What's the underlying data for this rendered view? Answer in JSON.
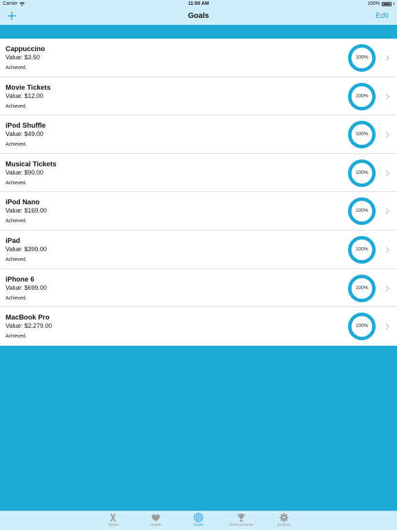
{
  "status_bar": {
    "carrier": "Carrier",
    "time": "11:00 AM",
    "battery": "100%"
  },
  "nav": {
    "title": "Goals",
    "edit_label": "Edit"
  },
  "goals": [
    {
      "name": "Cappuccino",
      "value": "Value: $3.50",
      "status": "Achieved.",
      "percent_label": "100%",
      "progress": 1.0
    },
    {
      "name": "Movie Tickets",
      "value": "Value: $12.00",
      "status": "Achieved.",
      "percent_label": "100%",
      "progress": 1.0
    },
    {
      "name": "iPod Shuffle",
      "value": "Value: $49.00",
      "status": "Achieved.",
      "percent_label": "100%",
      "progress": 1.0
    },
    {
      "name": "Musical Tickets",
      "value": "Value: $90.00",
      "status": "Achieved.",
      "percent_label": "100%",
      "progress": 1.0
    },
    {
      "name": "iPod Nano",
      "value": "Value: $169.00",
      "status": "Achieved.",
      "percent_label": "100%",
      "progress": 1.0
    },
    {
      "name": "iPad",
      "value": "Value: $399.00",
      "status": "Achieved.",
      "percent_label": "100%",
      "progress": 1.0
    },
    {
      "name": "iPhone 6",
      "value": "Value: $699.00",
      "status": "Achieved.",
      "percent_label": "100%",
      "progress": 1.0
    },
    {
      "name": "MacBook Pro",
      "value": "Value: $2,279.00",
      "status": "Achieved.",
      "percent_label": "100%",
      "progress": 1.0
    }
  ],
  "tabs": [
    {
      "label": "Status",
      "icon": "x-mark-icon"
    },
    {
      "label": "Health",
      "icon": "heart-icon"
    },
    {
      "label": "Goals",
      "icon": "target-icon",
      "active": true
    },
    {
      "label": "Achievements",
      "icon": "trophy-icon"
    },
    {
      "label": "Settings",
      "icon": "gear-icon"
    }
  ],
  "colors": {
    "accent": "#1fa9d6",
    "bar": "#cfeefa",
    "tint": "#2aa7dc",
    "ring_track": "#d6eef8"
  }
}
